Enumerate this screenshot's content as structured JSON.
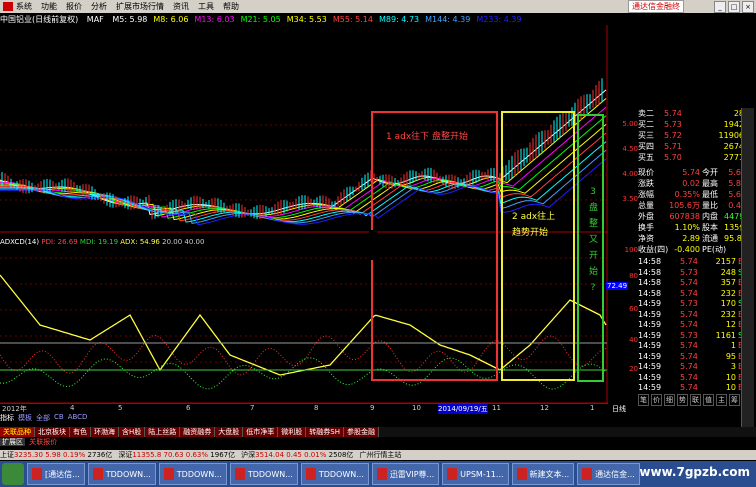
{
  "menu": {
    "items": [
      "系统",
      "功能",
      "报价",
      "分析",
      "扩展市场行情",
      "资讯",
      "工具",
      "帮助"
    ],
    "ad_label": "通达信金融终"
  },
  "title_line": {
    "stock": "中国铝业(日线前复权)",
    "ma_label": "MAF",
    "items": [
      {
        "text": "M5: 5.98",
        "color": "#ffffff"
      },
      {
        "text": "M8: 6.06",
        "color": "#ffff00"
      },
      {
        "text": "M13: 6.03",
        "color": "#ff00ff"
      },
      {
        "text": "M21: 5.05",
        "color": "#00ff00"
      },
      {
        "text": "M34: 5.53",
        "color": "#ffff00"
      },
      {
        "text": "M55: 5.14",
        "color": "#ff4040"
      },
      {
        "text": "M89: 4.73",
        "color": "#00ffff"
      },
      {
        "text": "M144: 4.39",
        "color": "#40a0ff"
      },
      {
        "text": "M233: 4.39",
        "color": "#2020ff"
      }
    ]
  },
  "price_axis": [
    "5.00",
    "4.50",
    "4.00",
    "3.50"
  ],
  "indicator_axis": [
    "100",
    "80",
    "60",
    "40",
    "20"
  ],
  "indicator_title": {
    "name": "ADXCD(14)",
    "pdi": "PDI: 26.69",
    "mdi": "MDI: 19.19",
    "adx": "ADX: 54.96",
    "v20": "20.00",
    "v40": "40.00"
  },
  "marker_value": "72.49",
  "annotations": {
    "a1": "1 adx往下 盘整开始",
    "a2_line1": "2 adx往上",
    "a2_line2": "趋势开始",
    "a3": [
      "3",
      "盘",
      "整",
      "又",
      "开",
      "始",
      "?"
    ]
  },
  "date_axis": [
    "2012年",
    "4",
    "5",
    "6",
    "7",
    "8",
    "9",
    "10",
    "2014/09/19/五",
    "11",
    "12",
    "1"
  ],
  "view_tabs": [
    "指标",
    "模板",
    "全部",
    "CB",
    "ABCD"
  ],
  "quote": {
    "asks": [
      {
        "label": "卖二",
        "price": "5.74",
        "vol": "28"
      },
      {
        "label": "买二",
        "price": "5.73",
        "vol": "1942"
      },
      {
        "label": "买三",
        "price": "5.72",
        "vol": "11906"
      },
      {
        "label": "买四",
        "price": "5.71",
        "vol": "2674"
      },
      {
        "label": "买五",
        "price": "5.70",
        "vol": "2771"
      }
    ],
    "stats": [
      {
        "a": "现价",
        "av": "5.74",
        "b": "今开",
        "bv": "5.66"
      },
      {
        "a": "涨跌",
        "av": "0.02",
        "b": "最高",
        "bv": "5.81"
      },
      {
        "a": "涨幅",
        "av": "0.35%",
        "b": "最低",
        "bv": "5.65"
      },
      {
        "a": "总量",
        "av": "105.6万",
        "b": "量比",
        "bv": "0.46"
      },
      {
        "a": "外盘",
        "av": "607838",
        "b": "内盘",
        "bv": "447943"
      },
      {
        "a": "换手",
        "av": "1.10%",
        "b": "股本",
        "bv": "135亿"
      },
      {
        "a": "净资",
        "av": "2.89",
        "b": "流通",
        "bv": "95.8亿"
      },
      {
        "a": "收益(四)",
        "av": "-0.400",
        "b": "PE(动)",
        "bv": ""
      }
    ],
    "ticks": [
      {
        "t": "14:58",
        "p": "5.74",
        "v": "2157",
        "s": "B"
      },
      {
        "t": "14:58",
        "p": "5.73",
        "v": "248",
        "s": "S"
      },
      {
        "t": "14:58",
        "p": "5.74",
        "v": "357",
        "s": "B"
      },
      {
        "t": "14:58",
        "p": "5.74",
        "v": "232",
        "s": "B"
      },
      {
        "t": "14:59",
        "p": "5.73",
        "v": "170",
        "s": "S"
      },
      {
        "t": "14:59",
        "p": "5.74",
        "v": "232",
        "s": "B"
      },
      {
        "t": "14:59",
        "p": "5.74",
        "v": "12",
        "s": "B"
      },
      {
        "t": "14:59",
        "p": "5.73",
        "v": "1161",
        "s": "S"
      },
      {
        "t": "14:59",
        "p": "5.74",
        "v": "1",
        "s": "B"
      },
      {
        "t": "14:59",
        "p": "5.74",
        "v": "95",
        "s": "B"
      },
      {
        "t": "14:59",
        "p": "5.74",
        "v": "3",
        "s": "B"
      },
      {
        "t": "14:59",
        "p": "5.74",
        "v": "10",
        "s": "B"
      },
      {
        "t": "14:59",
        "p": "5.74",
        "v": "10",
        "s": "B"
      }
    ],
    "bottom_tabs": [
      "笔",
      "价",
      "细",
      "势",
      "联",
      "值",
      "主",
      "筹"
    ]
  },
  "bottom_tabs": [
    "关联品种",
    "北京板块",
    "有色",
    "环渤海",
    "含H股",
    "陆上丝路",
    "融资融券",
    "大盘股",
    "低市净率",
    "微利股",
    "转融券SH",
    "参股金融"
  ],
  "status2": [
    "扩展区",
    "关联报价"
  ],
  "status3": {
    "items": [
      {
        "label": "上证",
        "value": "3235.30",
        "chg": "5.98",
        "pct": "0.19%",
        "vol": "2736亿"
      },
      {
        "label": "深证",
        "value": "11355.8",
        "chg": "70.63",
        "pct": "0.63%",
        "vol": "1967亿"
      },
      {
        "label": "沪深",
        "value": "3514.04",
        "chg": "0.45",
        "pct": "0.01%",
        "vol": "2508亿"
      }
    ],
    "right_text": "广州行情主站"
  },
  "taskbar": [
    "[通达信...",
    "TDDOWN...",
    "TDDOWN...",
    "TDDOWN...",
    "TDDOWN...",
    "迅雷VIP尊...",
    "UPSM-11...",
    "新建文本...",
    "通达信金..."
  ],
  "watermark": "www.7gpzb.com"
}
